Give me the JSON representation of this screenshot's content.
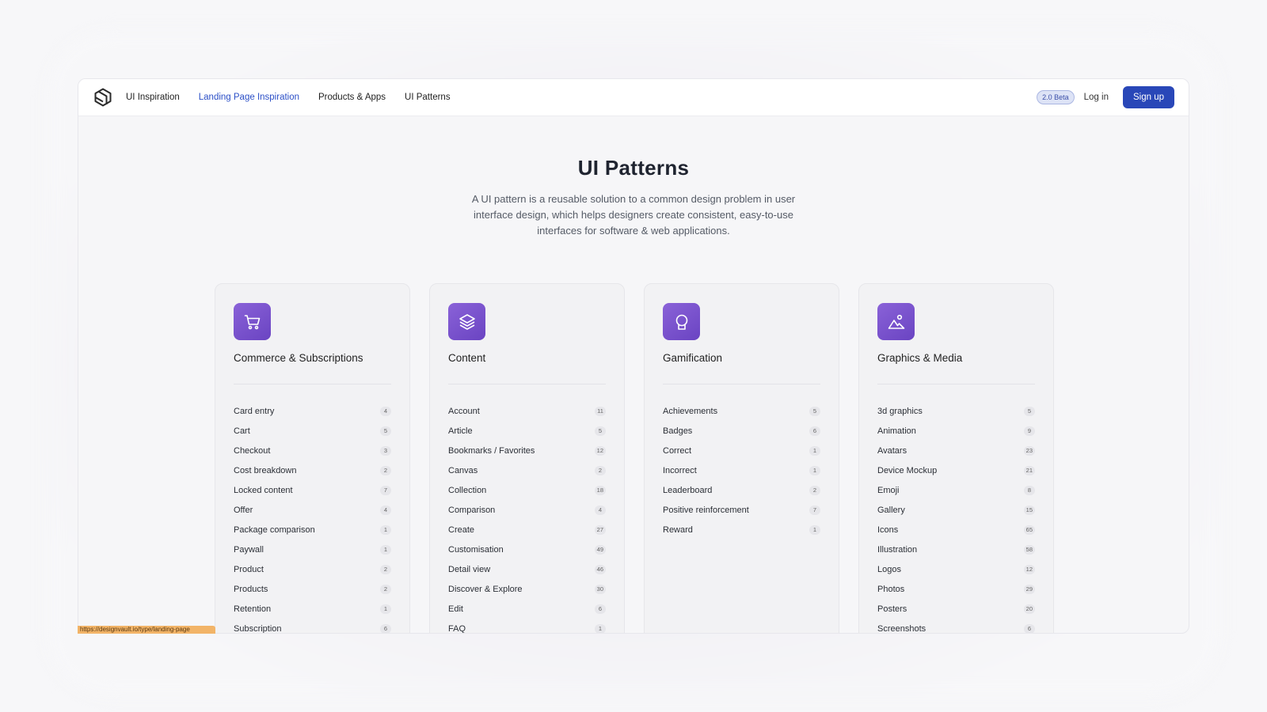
{
  "nav": {
    "links": [
      {
        "label": "UI Inspiration",
        "active": false
      },
      {
        "label": "Landing Page Inspiration",
        "active": true
      },
      {
        "label": "Products & Apps",
        "active": false
      },
      {
        "label": "UI Patterns",
        "active": false
      }
    ],
    "beta_badge": "2.0 Beta",
    "login_label": "Log in",
    "signup_label": "Sign up"
  },
  "hero": {
    "title": "UI Patterns",
    "description": "A UI pattern is a reusable solution to a common design problem in user interface design, which helps designers create consistent, easy-to-use interfaces for software & web applications."
  },
  "colors": {
    "accent": "#2947b8",
    "icon_gradient_start": "#8a62d8",
    "icon_gradient_end": "#6a44c2",
    "status_bar": "#f2b468"
  },
  "categories": [
    {
      "title": "Commerce & Subscriptions",
      "icon": "cart-icon",
      "items": [
        {
          "label": "Card entry",
          "count": "4"
        },
        {
          "label": "Cart",
          "count": "5"
        },
        {
          "label": "Checkout",
          "count": "3"
        },
        {
          "label": "Cost breakdown",
          "count": "2"
        },
        {
          "label": "Locked content",
          "count": "7"
        },
        {
          "label": "Offer",
          "count": "4"
        },
        {
          "label": "Package comparison",
          "count": "1"
        },
        {
          "label": "Paywall",
          "count": "1"
        },
        {
          "label": "Product",
          "count": "2"
        },
        {
          "label": "Products",
          "count": "2"
        },
        {
          "label": "Retention",
          "count": "1"
        },
        {
          "label": "Subscription",
          "count": "6"
        }
      ]
    },
    {
      "title": "Content",
      "icon": "layers-icon",
      "items": [
        {
          "label": "Account",
          "count": "11"
        },
        {
          "label": "Article",
          "count": "5"
        },
        {
          "label": "Bookmarks / Favorites",
          "count": "12"
        },
        {
          "label": "Canvas",
          "count": "2"
        },
        {
          "label": "Collection",
          "count": "18"
        },
        {
          "label": "Comparison",
          "count": "4"
        },
        {
          "label": "Create",
          "count": "27"
        },
        {
          "label": "Customisation",
          "count": "49"
        },
        {
          "label": "Detail view",
          "count": "46"
        },
        {
          "label": "Discover & Explore",
          "count": "30"
        },
        {
          "label": "Edit",
          "count": "6"
        },
        {
          "label": "FAQ",
          "count": "1"
        }
      ]
    },
    {
      "title": "Gamification",
      "icon": "medal-icon",
      "items": [
        {
          "label": "Achievements",
          "count": "5"
        },
        {
          "label": "Badges",
          "count": "6"
        },
        {
          "label": "Correct",
          "count": "1"
        },
        {
          "label": "Incorrect",
          "count": "1"
        },
        {
          "label": "Leaderboard",
          "count": "2"
        },
        {
          "label": "Positive reinforcement",
          "count": "7"
        },
        {
          "label": "Reward",
          "count": "1"
        }
      ]
    },
    {
      "title": "Graphics & Media",
      "icon": "image-icon",
      "items": [
        {
          "label": "3d graphics",
          "count": "5"
        },
        {
          "label": "Animation",
          "count": "9"
        },
        {
          "label": "Avatars",
          "count": "23"
        },
        {
          "label": "Device Mockup",
          "count": "21"
        },
        {
          "label": "Emoji",
          "count": "8"
        },
        {
          "label": "Gallery",
          "count": "15"
        },
        {
          "label": "Icons",
          "count": "65"
        },
        {
          "label": "Illustration",
          "count": "58"
        },
        {
          "label": "Logos",
          "count": "12"
        },
        {
          "label": "Photos",
          "count": "29"
        },
        {
          "label": "Posters",
          "count": "20"
        },
        {
          "label": "Screenshots",
          "count": "6"
        }
      ]
    }
  ],
  "status_url": "https://designvault.io/type/landing-page"
}
